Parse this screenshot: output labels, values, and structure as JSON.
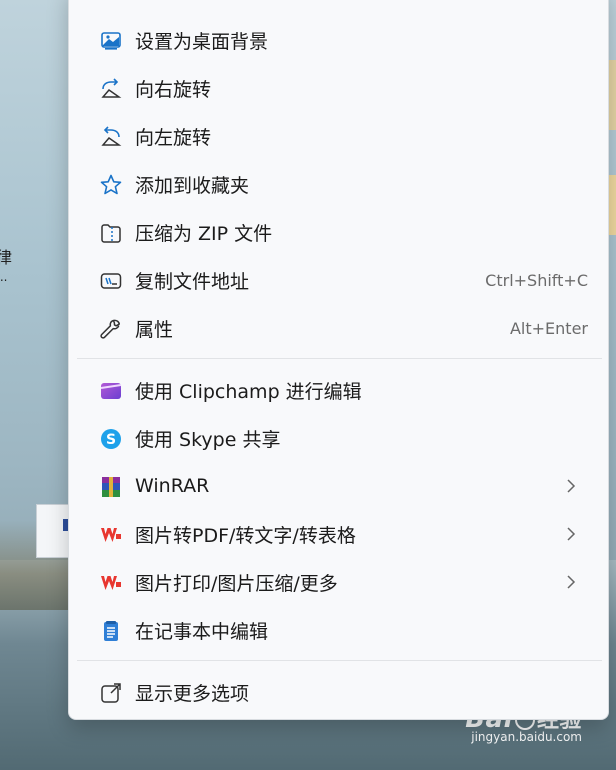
{
  "desktop": {
    "left_text_1": "律",
    "left_text_2": "...",
    "watermark": {
      "logo": "Bai",
      "logo_cn": "经验",
      "url": "jingyan.baidu.com"
    }
  },
  "menu": {
    "items": [
      {
        "label": "设置为桌面背景",
        "icon": "set-as-wallpaper-icon"
      },
      {
        "label": "向右旋转",
        "icon": "rotate-right-icon"
      },
      {
        "label": "向左旋转",
        "icon": "rotate-left-icon"
      },
      {
        "label": "添加到收藏夹",
        "icon": "star-icon"
      },
      {
        "label": "压缩为 ZIP 文件",
        "icon": "zip-folder-icon"
      },
      {
        "label": "复制文件地址",
        "icon": "copy-path-icon",
        "shortcut": "Ctrl+Shift+C"
      },
      {
        "label": "属性",
        "icon": "wrench-icon",
        "shortcut": "Alt+Enter"
      }
    ],
    "apps": [
      {
        "label": "使用 Clipchamp 进行编辑",
        "icon": "clipchamp-icon"
      },
      {
        "label": "使用 Skype 共享",
        "icon": "skype-icon"
      },
      {
        "label": "WinRAR",
        "icon": "winrar-icon",
        "submenu": true
      },
      {
        "label": "图片转PDF/转文字/转表格",
        "icon": "wps-icon",
        "submenu": true
      },
      {
        "label": "图片打印/图片压缩/更多",
        "icon": "wps-icon",
        "submenu": true
      },
      {
        "label": "在记事本中编辑",
        "icon": "notepad-icon"
      }
    ],
    "more": {
      "label": "显示更多选项",
      "icon": "open-external-icon"
    }
  },
  "colors": {
    "accent_blue": "#1a73c8",
    "wps_red": "#e8362f",
    "clipchamp_purple": "#8a4bd6",
    "menu_bg": "#f8f9fb"
  }
}
